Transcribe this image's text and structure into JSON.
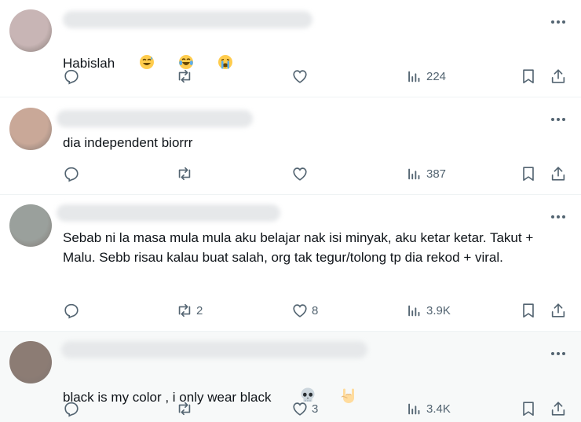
{
  "posts": [
    {
      "text": "Habislah",
      "emojis": [
        "sweat-smile",
        "tears-of-joy",
        "crying"
      ],
      "counts": {
        "reply": "",
        "repost": "",
        "like": "",
        "views": "224"
      },
      "avatar_color": "#c8b5b5",
      "highlight": false
    },
    {
      "text": "dia independent biorrr",
      "emojis": [],
      "counts": {
        "reply": "",
        "repost": "",
        "like": "",
        "views": "387"
      },
      "avatar_color": "#c9a898",
      "highlight": false
    },
    {
      "text": "Sebab ni la masa mula mula aku belajar nak isi minyak, aku ketar ketar. Takut + Malu. Sebb risau kalau buat salah, org tak tegur/tolong tp dia rekod + viral.",
      "emojis": [],
      "counts": {
        "reply": "",
        "repost": "2",
        "like": "8",
        "views": "3.9K"
      },
      "avatar_color": "#9aa09c",
      "highlight": false
    },
    {
      "text": "black is my color , i only wear black",
      "emojis": [
        "skull",
        "rock-on-hand"
      ],
      "counts": {
        "reply": "",
        "repost": "",
        "like": "3",
        "views": "3.4K"
      },
      "avatar_color": "#8c7c74",
      "highlight": true
    }
  ],
  "icons": {
    "more": "more-horizontal-icon",
    "reply": "reply-icon",
    "repost": "repost-icon",
    "like": "heart-icon",
    "views": "views-icon",
    "bookmark": "bookmark-icon",
    "share": "share-icon"
  },
  "colors": {
    "icon": "#536471",
    "text": "#0f1419",
    "divider": "#eff3f4",
    "highlight_bg": "#f7f9f9"
  }
}
